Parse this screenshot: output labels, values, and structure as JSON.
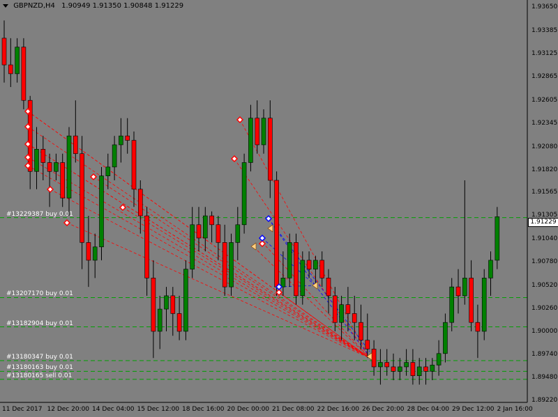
{
  "header": {
    "symbol": "GBPNZD,H4",
    "ohlc": "1.90949 1.91350 1.90848 1.91229"
  },
  "price_axis": {
    "ticks": [
      "1.93650",
      "1.93385",
      "1.93125",
      "1.92865",
      "1.92605",
      "1.92345",
      "1.92080",
      "1.91820",
      "1.91565",
      "1.91305",
      "1.91040",
      "1.90780",
      "1.90520",
      "1.90260",
      "1.90000",
      "1.89740",
      "1.89480",
      "1.89220"
    ],
    "current_price": "1.91229"
  },
  "time_axis": {
    "ticks": [
      "11 Dec 2017",
      "12 Dec 20:00",
      "14 Dec 04:00",
      "15 Dec 12:00",
      "18 Dec 16:00",
      "20 Dec 00:00",
      "21 Dec 08:00",
      "22 Dec 16:00",
      "26 Dec 20:00",
      "28 Dec 04:00",
      "29 Dec 12:00",
      "2 Jan 16:00"
    ]
  },
  "orders": [
    {
      "label": "#13229387 buy 0.01",
      "price": 1.9128
    },
    {
      "label": "#13207170 buy 0.01",
      "price": 1.9038
    },
    {
      "label": "#13182904 buy 0.01",
      "price": 1.9005
    },
    {
      "label": "#13180347 buy 0.01",
      "price": 1.8967
    },
    {
      "label": "#13180163 buy 0.01",
      "price": 1.8955
    },
    {
      "label": "#13180165 sell 0.01",
      "price": 1.8946
    }
  ],
  "colors": {
    "background": "#808080",
    "bull": "#008000",
    "bear": "#ff0000",
    "order_line": "#00a000",
    "trade_red": "#ff0000",
    "trade_blue": "#0000ff"
  },
  "chart_data": {
    "type": "candlestick",
    "symbol": "GBPNZD",
    "timeframe": "H4",
    "ylim": [
      1.892,
      1.9373
    ],
    "candles": [
      [
        1.933,
        1.935,
        1.928,
        1.93
      ],
      [
        1.93,
        1.933,
        1.9275,
        1.929
      ],
      [
        1.929,
        1.933,
        1.928,
        1.932
      ],
      [
        1.932,
        1.933,
        1.925,
        1.926
      ],
      [
        1.926,
        1.9265,
        1.916,
        1.918
      ],
      [
        1.918,
        1.923,
        1.916,
        1.9205
      ],
      [
        1.9205,
        1.922,
        1.917,
        1.919
      ],
      [
        1.919,
        1.92,
        1.914,
        1.918
      ],
      [
        1.918,
        1.92,
        1.917,
        1.919
      ],
      [
        1.919,
        1.92,
        1.914,
        1.915
      ],
      [
        1.915,
        1.923,
        1.913,
        1.922
      ],
      [
        1.922,
        1.926,
        1.919,
        1.92
      ],
      [
        1.92,
        1.922,
        1.907,
        1.91
      ],
      [
        1.91,
        1.913,
        1.905,
        1.908
      ],
      [
        1.908,
        1.911,
        1.906,
        1.9095
      ],
      [
        1.9095,
        1.9185,
        1.908,
        1.9175
      ],
      [
        1.9175,
        1.92,
        1.916,
        1.9185
      ],
      [
        1.9185,
        1.922,
        1.917,
        1.921
      ],
      [
        1.921,
        1.924,
        1.919,
        1.922
      ],
      [
        1.922,
        1.924,
        1.92,
        1.9215
      ],
      [
        1.9215,
        1.9225,
        1.914,
        1.916
      ],
      [
        1.916,
        1.917,
        1.911,
        1.913
      ],
      [
        1.913,
        1.914,
        1.904,
        1.906
      ],
      [
        1.906,
        1.908,
        1.897,
        1.9
      ],
      [
        1.9,
        1.904,
        1.898,
        1.9025
      ],
      [
        1.9025,
        1.905,
        1.9,
        1.904
      ],
      [
        1.904,
        1.905,
        1.8995,
        1.902
      ],
      [
        1.902,
        1.904,
        1.899,
        1.9
      ],
      [
        1.9,
        1.908,
        1.899,
        1.907
      ],
      [
        1.907,
        1.914,
        1.906,
        1.912
      ],
      [
        1.912,
        1.914,
        1.909,
        1.9105
      ],
      [
        1.9105,
        1.914,
        1.909,
        1.913
      ],
      [
        1.913,
        1.9135,
        1.91,
        1.912
      ],
      [
        1.912,
        1.913,
        1.908,
        1.91
      ],
      [
        1.91,
        1.912,
        1.904,
        1.905
      ],
      [
        1.905,
        1.911,
        1.904,
        1.91
      ],
      [
        1.91,
        1.914,
        1.908,
        1.912
      ],
      [
        1.912,
        1.92,
        1.911,
        1.919
      ],
      [
        1.919,
        1.9255,
        1.918,
        1.924
      ],
      [
        1.924,
        1.926,
        1.92,
        1.921
      ],
      [
        1.921,
        1.925,
        1.92,
        1.924
      ],
      [
        1.924,
        1.926,
        1.915,
        1.917
      ],
      [
        1.917,
        1.918,
        1.904,
        1.905
      ],
      [
        1.905,
        1.909,
        1.904,
        1.906
      ],
      [
        1.906,
        1.911,
        1.905,
        1.91
      ],
      [
        1.91,
        1.911,
        1.903,
        1.904
      ],
      [
        1.904,
        1.909,
        1.903,
        1.908
      ],
      [
        1.908,
        1.909,
        1.906,
        1.907
      ],
      [
        1.907,
        1.9085,
        1.905,
        1.908
      ],
      [
        1.908,
        1.909,
        1.905,
        1.906
      ],
      [
        1.906,
        1.907,
        1.902,
        1.904
      ],
      [
        1.904,
        1.905,
        1.9,
        1.901
      ],
      [
        1.901,
        1.904,
        1.899,
        1.903
      ],
      [
        1.903,
        1.905,
        1.9,
        1.902
      ],
      [
        1.902,
        1.904,
        1.899,
        1.901
      ],
      [
        1.901,
        1.903,
        1.898,
        1.899
      ],
      [
        1.899,
        1.902,
        1.897,
        1.898
      ],
      [
        1.898,
        1.899,
        1.895,
        1.896
      ],
      [
        1.896,
        1.898,
        1.894,
        1.8965
      ],
      [
        1.8965,
        1.898,
        1.895,
        1.896
      ],
      [
        1.896,
        1.8975,
        1.8945,
        1.8955
      ],
      [
        1.8955,
        1.897,
        1.8945,
        1.896
      ],
      [
        1.896,
        1.898,
        1.895,
        1.8965
      ],
      [
        1.8965,
        1.898,
        1.894,
        1.895
      ],
      [
        1.895,
        1.897,
        1.894,
        1.896
      ],
      [
        1.896,
        1.897,
        1.894,
        1.8955
      ],
      [
        1.8955,
        1.897,
        1.8945,
        1.8962
      ],
      [
        1.8962,
        1.899,
        1.895,
        1.8975
      ],
      [
        1.8975,
        1.902,
        1.8965,
        1.901
      ],
      [
        1.901,
        1.906,
        1.9,
        1.905
      ],
      [
        1.905,
        1.907,
        1.902,
        1.904
      ],
      [
        1.904,
        1.917,
        1.903,
        1.906
      ],
      [
        1.906,
        1.908,
        1.9,
        1.901
      ],
      [
        1.901,
        1.903,
        1.897,
        1.9
      ],
      [
        1.9,
        1.907,
        1.899,
        1.906
      ],
      [
        1.906,
        1.909,
        1.904,
        1.908
      ],
      [
        1.908,
        1.914,
        1.907,
        1.9129
      ]
    ]
  }
}
